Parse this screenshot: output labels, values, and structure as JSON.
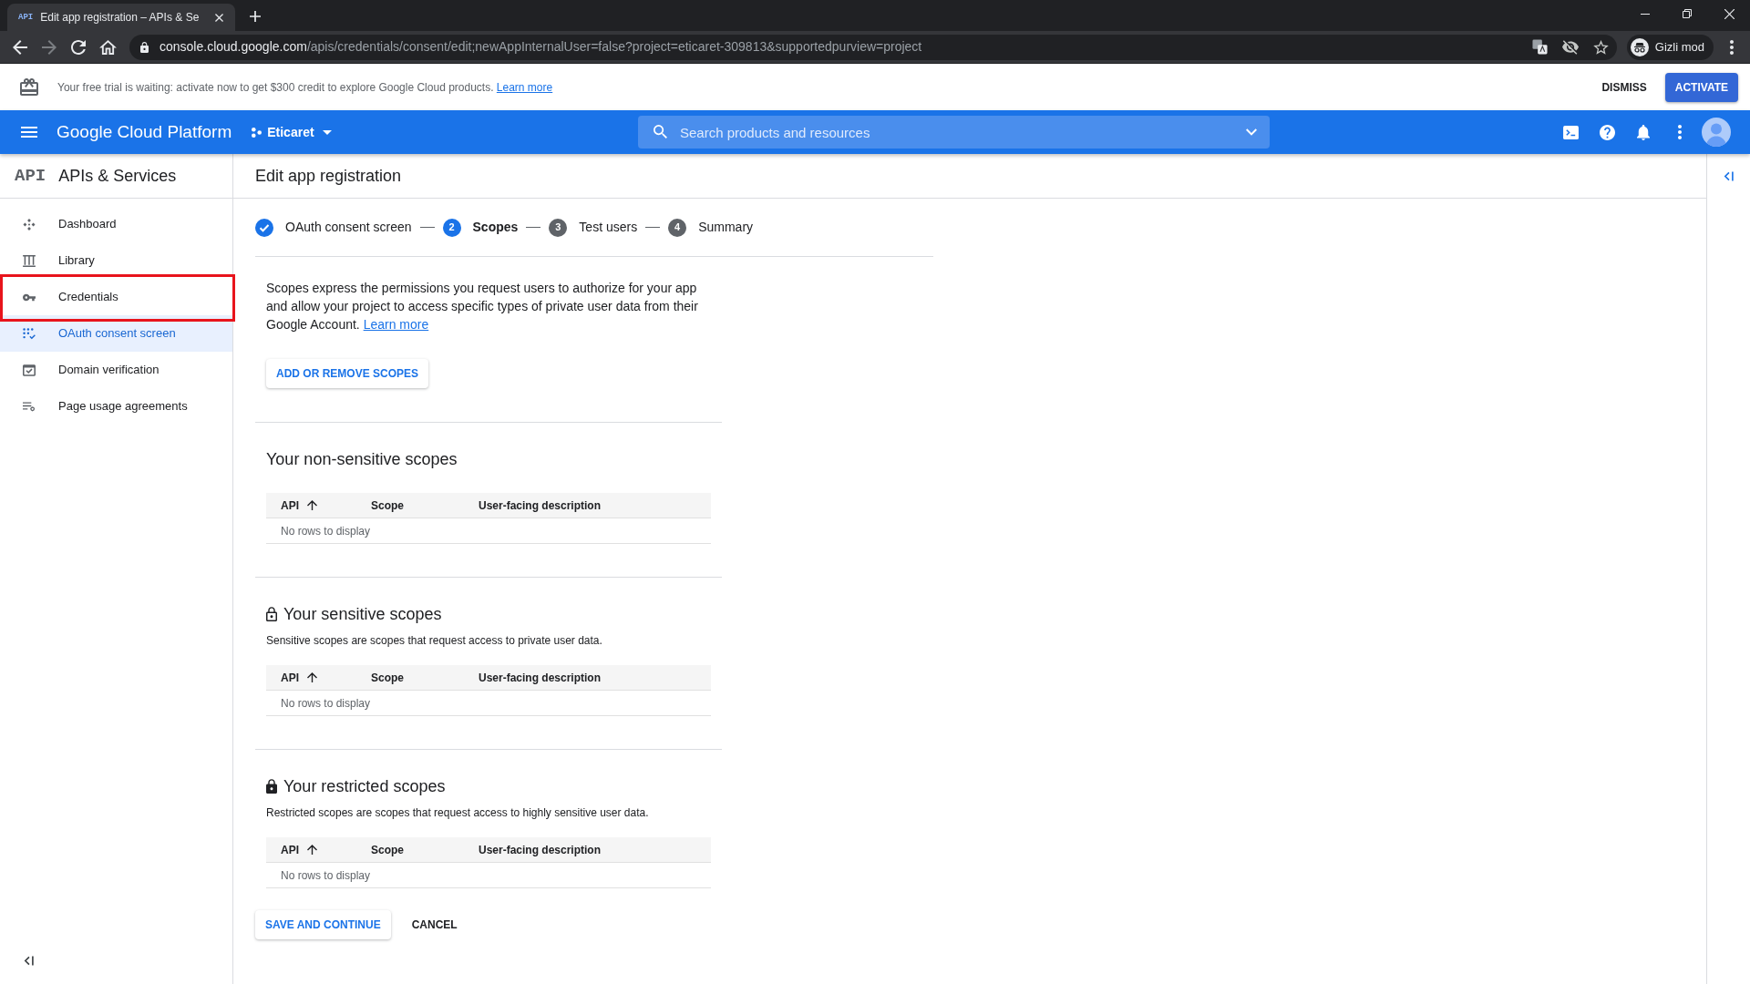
{
  "browser": {
    "tab": {
      "favicon": "API",
      "title": "Edit app registration – APIs & Se"
    },
    "forward_button": {
      "disabled": true
    },
    "url": {
      "host": "console.cloud.google.com",
      "path": "/apis/credentials/consent/edit;newAppInternalUser=false?project=eticaret-309813&supportedpurview=project"
    },
    "profile": "Gizli mod"
  },
  "banner": {
    "text": "Your free trial is waiting: activate now to get $300 credit to explore Google Cloud products.",
    "link": "Learn more",
    "dismiss": "DISMISS",
    "activate": "ACTIVATE"
  },
  "header": {
    "title": "Google Cloud Platform",
    "project": "Eticaret",
    "search": {
      "placeholder": "Search products and resources"
    }
  },
  "sidebar": {
    "logo": "API",
    "title": "APIs & Services",
    "items": [
      {
        "label": "Dashboard",
        "selected": false,
        "annotated": false
      },
      {
        "label": "Library",
        "selected": false,
        "annotated": false
      },
      {
        "label": "Credentials",
        "selected": false,
        "annotated": true
      },
      {
        "label": "OAuth consent screen",
        "selected": true,
        "annotated": false
      },
      {
        "label": "Domain verification",
        "selected": false,
        "annotated": false
      },
      {
        "label": "Page usage agreements",
        "selected": false,
        "annotated": false
      }
    ]
  },
  "page": {
    "title": "Edit app registration",
    "steps": [
      {
        "label": "OAuth consent screen",
        "done": true,
        "selected": false
      },
      {
        "number": "2",
        "label": "Scopes",
        "done": false,
        "selected": true
      },
      {
        "number": "3",
        "label": "Test users",
        "done": false,
        "selected": false
      },
      {
        "number": "4",
        "label": "Summary",
        "done": false,
        "selected": false
      }
    ],
    "intro": "Scopes express the permissions you request users to authorize for your app and allow your project to access specific types of private user data from their Google Account.",
    "intro_link": "Learn more",
    "add_button": "ADD OR REMOVE SCOPES",
    "sections": [
      {
        "kind": "non_sensitive",
        "title": "Your non-sensitive scopes",
        "columns": [
          {
            "label": "API",
            "sorted": true
          },
          {
            "label": "Scope",
            "sorted": false
          },
          {
            "label": "User-facing description",
            "sorted": false
          }
        ],
        "empty_text": "No rows to display"
      },
      {
        "kind": "sensitive",
        "title": "Your sensitive scopes",
        "description": "Sensitive scopes are scopes that request access to private user data.",
        "columns": [
          {
            "label": "API",
            "sorted": true
          },
          {
            "label": "Scope",
            "sorted": false
          },
          {
            "label": "User-facing description",
            "sorted": false
          }
        ],
        "empty_text": "No rows to display"
      },
      {
        "kind": "restricted",
        "title": "Your restricted scopes",
        "description": "Restricted scopes are scopes that request access to highly sensitive user data.",
        "columns": [
          {
            "label": "API",
            "sorted": true
          },
          {
            "label": "Scope",
            "sorted": false
          },
          {
            "label": "User-facing description",
            "sorted": false
          }
        ],
        "empty_text": "No rows to display"
      }
    ],
    "save": "SAVE AND CONTINUE",
    "cancel": "CANCEL"
  }
}
